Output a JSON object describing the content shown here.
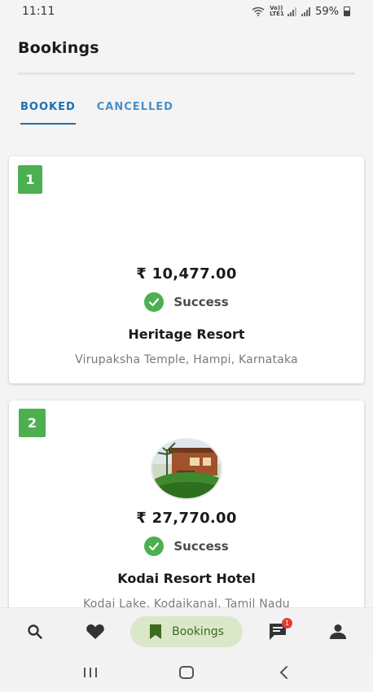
{
  "status_bar": {
    "time": "11:11",
    "network_label": "Vo)) LTE1",
    "battery_percent": "59%"
  },
  "header": {
    "title": "Bookings"
  },
  "tabs": [
    {
      "label": "BOOKED",
      "active": true
    },
    {
      "label": "CANCELLED",
      "active": false
    }
  ],
  "bookings": [
    {
      "number": "1",
      "price": "₹ 10,477.00",
      "status": "Success",
      "hotel": "Heritage Resort",
      "location": "Virupaksha Temple, Hampi, Karnataka"
    },
    {
      "number": "2",
      "price": "₹ 27,770.00",
      "status": "Success",
      "hotel": "Kodai Resort Hotel",
      "location": "Kodai Lake, Kodaikanal, Tamil Nadu"
    }
  ],
  "bottom_nav": {
    "items": [
      {
        "icon": "search-icon"
      },
      {
        "icon": "heart-icon"
      },
      {
        "icon": "bookmark-icon",
        "label": "Bookings",
        "active": true
      },
      {
        "icon": "chat-icon",
        "badge": "1"
      },
      {
        "icon": "person-icon"
      }
    ]
  },
  "colors": {
    "accent_blue": "#1f6fb0",
    "success_green": "#4caf50",
    "active_pill": "#dbe7c9"
  }
}
